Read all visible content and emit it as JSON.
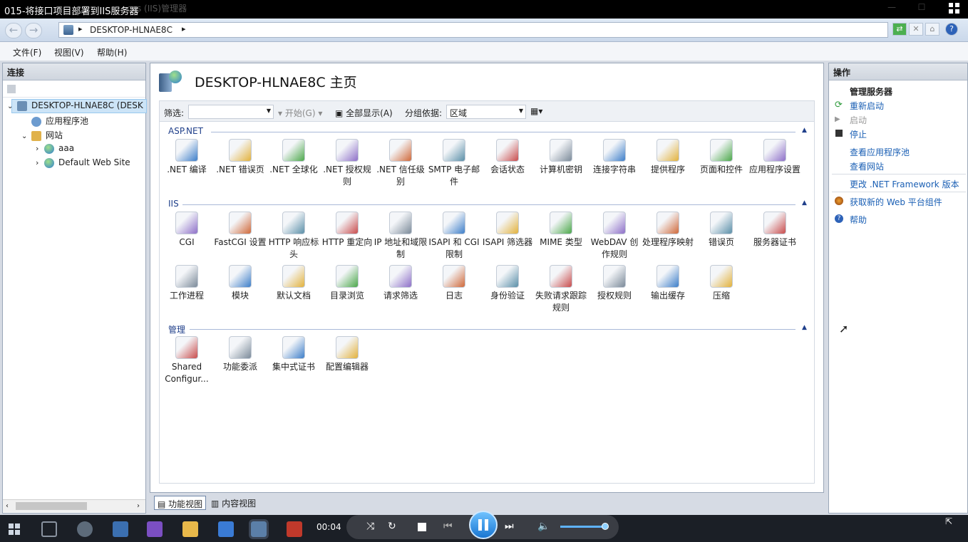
{
  "window": {
    "title": "015-将接口项目部署到IIS服务器",
    "ghost_title": "ces (IIS)管理器"
  },
  "address": {
    "path": "DESKTOP-HLNAE8C",
    "separator": "▸"
  },
  "menu": [
    "文件(F)",
    "视图(V)",
    "帮助(H)"
  ],
  "left_pane": {
    "header": "连接",
    "tree": [
      {
        "label": "DESKTOP-HLNAE8C (DESK",
        "level": 0,
        "expand": "⌄"
      },
      {
        "label": "应用程序池",
        "level": 1,
        "expand": ""
      },
      {
        "label": "网站",
        "level": 1,
        "expand": "⌄"
      },
      {
        "label": "aaa",
        "level": 2,
        "expand": "›"
      },
      {
        "label": "Default Web Site",
        "level": 2,
        "expand": "›"
      }
    ]
  },
  "center": {
    "title": "DESKTOP-HLNAE8C 主页",
    "filter_label": "筛选:",
    "start_label": "开始(G)",
    "show_all_label": "全部显示(A)",
    "group_label": "分组依据:",
    "group_value": "区域",
    "sections": [
      {
        "name": "ASP.NET",
        "items": [
          ".NET 编译",
          ".NET 错误页",
          ".NET 全球化",
          ".NET 授权规则",
          ".NET 信任级别",
          "SMTP 电子邮件",
          "会话状态",
          "计算机密钥",
          "连接字符串",
          "提供程序",
          "页面和控件",
          "应用程序设置"
        ]
      },
      {
        "name": "IIS",
        "items": [
          "CGI",
          "FastCGI 设置",
          "HTTP 响应标头",
          "HTTP 重定向",
          "IP 地址和域限制",
          "ISAPI 和 CGI 限制",
          "ISAPI 筛选器",
          "MIME 类型",
          "WebDAV 创作规则",
          "处理程序映射",
          "错误页",
          "服务器证书",
          "工作进程",
          "模块",
          "默认文档",
          "目录浏览",
          "请求筛选",
          "日志",
          "身份验证",
          "失败请求跟踪规则",
          "授权规则",
          "输出缓存",
          "压缩"
        ]
      },
      {
        "name": "管理",
        "items": [
          "Shared Configur...",
          "功能委派",
          "集中式证书",
          "配置编辑器"
        ]
      }
    ],
    "tabs": [
      "功能视图",
      "内容视图"
    ]
  },
  "right_pane": {
    "header": "操作",
    "group_title": "管理服务器",
    "actions": [
      {
        "label": "重新启动",
        "enabled": true
      },
      {
        "label": "启动",
        "enabled": false
      },
      {
        "label": "停止",
        "enabled": true
      },
      {
        "label": "查看应用程序池",
        "enabled": true
      },
      {
        "label": "查看网站",
        "enabled": true
      },
      {
        "label": "更改 .NET Framework 版本",
        "enabled": true
      },
      {
        "label": "获取新的 Web 平台组件",
        "enabled": true
      },
      {
        "label": "帮助",
        "enabled": true
      }
    ]
  },
  "player": {
    "time": "00:04",
    "volume_fraction": 0.92
  },
  "colors": {
    "accent": "#1a5fb4",
    "section": "#1f3f8a"
  }
}
